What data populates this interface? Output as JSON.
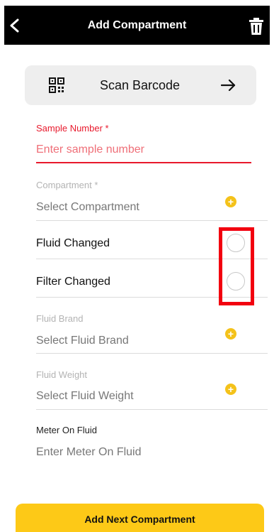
{
  "header": {
    "title": "Add Compartment",
    "back_icon": "chevron-left-icon",
    "delete_icon": "trash-icon"
  },
  "scan": {
    "label": "Scan Barcode",
    "qr_icon": "qr-code-icon",
    "arrow_icon": "arrow-right-icon"
  },
  "sample_number": {
    "label": "Sample Number *",
    "placeholder": "Enter sample number"
  },
  "compartment": {
    "label": "Compartment *",
    "value": "Select Compartment"
  },
  "fluid_changed": {
    "label": "Fluid Changed",
    "checked": false
  },
  "filter_changed": {
    "label": "Filter Changed",
    "checked": false
  },
  "fluid_brand": {
    "label": "Fluid Brand",
    "value": "Select Fluid Brand"
  },
  "fluid_weight": {
    "label": "Fluid Weight",
    "value": "Select Fluid Weight"
  },
  "meter_on_fluid": {
    "label": "Meter On Fluid",
    "placeholder": "Enter Meter On Fluid"
  },
  "actions": {
    "add_next": "Add Next Compartment"
  },
  "colors": {
    "header_bg": "#000000",
    "accent_yellow": "#fdc917",
    "required_red": "#e8192c",
    "highlight_red": "#f2000f"
  }
}
